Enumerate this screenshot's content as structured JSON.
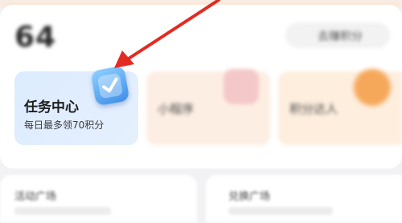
{
  "header": {
    "points_value": "64",
    "action_label": "去赚积分"
  },
  "cards": [
    {
      "title": "任务中心",
      "subtitle": "每日最多领70积分"
    },
    {
      "title": "小程序"
    },
    {
      "title": "积分达人"
    }
  ],
  "bottom_cards": [
    {
      "title": "活动广场"
    },
    {
      "title": "兑换广场"
    }
  ],
  "colors": {
    "arrow": "#e32b22",
    "task_card_bg": "#dcebff",
    "task_icon": "#4a9cf0"
  },
  "icons": {
    "task": "task-check-icon"
  }
}
